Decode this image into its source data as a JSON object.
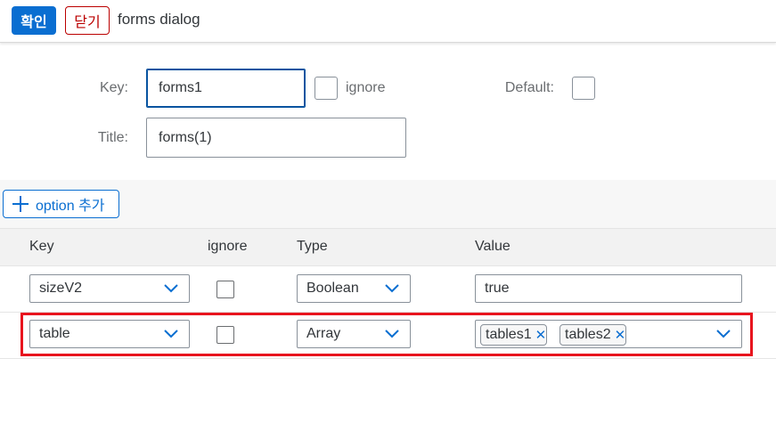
{
  "header": {
    "ok_label": "확인",
    "close_label": "닫기",
    "title": "forms dialog"
  },
  "form": {
    "key_label": "Key:",
    "key_value": "forms1",
    "ignore_label": "ignore",
    "default_label": "Default:",
    "title_label": "Title:",
    "title_value": "forms(1)"
  },
  "toolbar": {
    "add_option_label": "option 추가"
  },
  "table": {
    "columns": [
      "Key",
      "ignore",
      "Type",
      "Value"
    ],
    "rows": [
      {
        "key": "sizeV2",
        "ignore": false,
        "type": "Boolean",
        "value": "true"
      },
      {
        "key": "table",
        "ignore": false,
        "type": "Array",
        "tokens": [
          "tables1",
          "tables2"
        ]
      }
    ]
  },
  "colors": {
    "accent": "#0a6ed1",
    "reject": "#bb0000",
    "highlight": "#e8141e"
  }
}
